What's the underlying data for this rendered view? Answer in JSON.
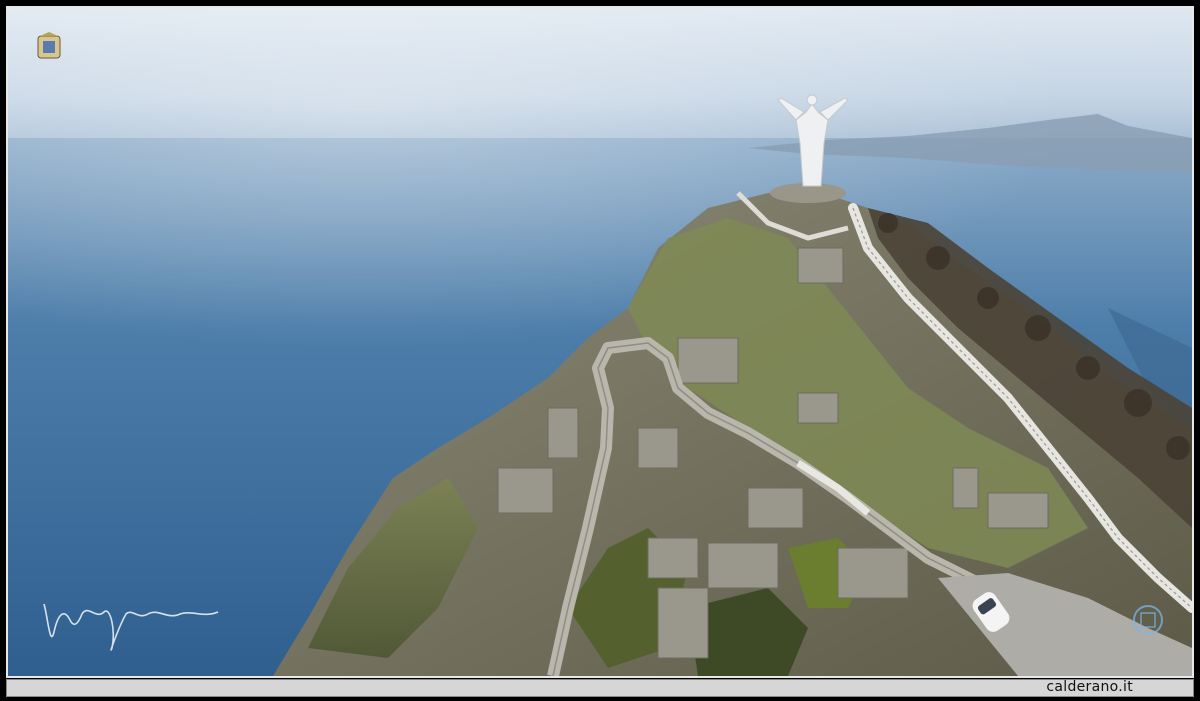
{
  "footer": {
    "credit_text": "calderano.it"
  },
  "photo": {
    "subject": "aerial-view-statue-on-coastal-mountain",
    "emblem_icon": "coat-of-arms-icon",
    "signature_icon": "handwritten-signature-icon",
    "watermark_icon": "round-logo-watermark-icon"
  },
  "colors": {
    "sea": "#3d6fa0",
    "sky": "#c9d8e8",
    "rock": "#7a7a6a",
    "vegetation": "#5d6a3a",
    "frame": "#000000",
    "footer_bg": "#d6d6d6"
  }
}
